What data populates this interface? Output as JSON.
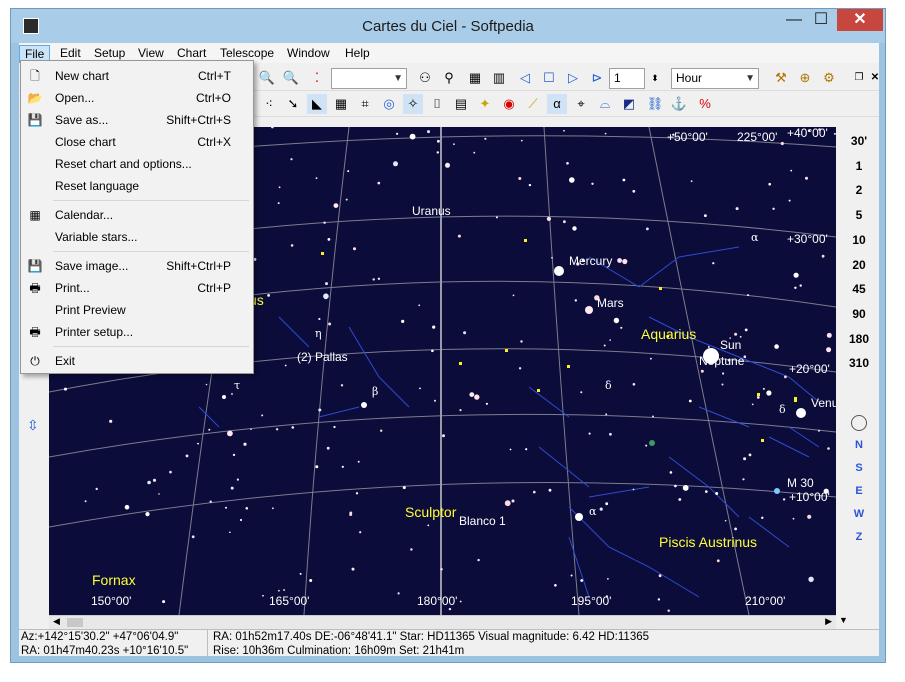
{
  "window": {
    "title": "Cartes du Ciel - Softpedia",
    "min": "—",
    "max": "☐",
    "close": "✕"
  },
  "menu": [
    {
      "label": "File"
    },
    {
      "label": "Edit"
    },
    {
      "label": "Setup"
    },
    {
      "label": "View"
    },
    {
      "label": "Chart"
    },
    {
      "label": "Telescope"
    },
    {
      "label": "Window"
    },
    {
      "label": "Help"
    }
  ],
  "file_menu": [
    {
      "icon": "🗋",
      "icon_name": "new-chart-icon",
      "label": "New chart",
      "shortcut": "Ctrl+T"
    },
    {
      "icon": "📂",
      "icon_name": "open-folder-icon",
      "label": "Open...",
      "shortcut": "Ctrl+O"
    },
    {
      "icon": "💾",
      "icon_name": "save-disk-icon",
      "label": "Save as...",
      "shortcut": "Shift+Ctrl+S"
    },
    {
      "icon": "",
      "icon_name": "",
      "label": "Close chart",
      "shortcut": "Ctrl+X"
    },
    {
      "icon": "",
      "icon_name": "",
      "label": "Reset chart and options...",
      "shortcut": ""
    },
    {
      "icon": "",
      "icon_name": "",
      "label": "Reset language",
      "shortcut": ""
    },
    {
      "sep": true
    },
    {
      "icon": "▦",
      "icon_name": "calendar-icon",
      "label": "Calendar...",
      "shortcut": ""
    },
    {
      "icon": "",
      "icon_name": "",
      "label": "Variable stars...",
      "shortcut": ""
    },
    {
      "sep": true
    },
    {
      "icon": "💾",
      "icon_name": "save-image-icon",
      "label": "Save image...",
      "shortcut": "Shift+Ctrl+P"
    },
    {
      "icon": "🖶",
      "icon_name": "print-icon",
      "label": "Print...",
      "shortcut": "Ctrl+P"
    },
    {
      "icon": "",
      "icon_name": "",
      "label": "Print Preview",
      "shortcut": ""
    },
    {
      "icon": "🖶",
      "icon_name": "printer-setup-icon",
      "label": "Printer setup...",
      "shortcut": ""
    },
    {
      "sep": true
    },
    {
      "icon": "⏻",
      "icon_name": "exit-icon",
      "label": "Exit",
      "shortcut": ""
    }
  ],
  "toolbar": {
    "object_combo": "",
    "step_value": "1",
    "time_unit": "Hour"
  },
  "fov_scale": [
    "30'",
    "1",
    "2",
    "5",
    "10",
    "20",
    "45",
    "90",
    "180",
    "310"
  ],
  "directions": [
    "N",
    "S",
    "E",
    "W",
    "Z"
  ],
  "sky": {
    "labels": [
      {
        "text": "Uranus",
        "color": "#ffffff"
      },
      {
        "text": "Mercury",
        "color": "#ffffff"
      },
      {
        "text": "Mars",
        "color": "#ffffff"
      },
      {
        "text": "Aquarius",
        "color": "#ffff33"
      },
      {
        "text": "Sun",
        "color": "#ffffff"
      },
      {
        "text": "Neptune",
        "color": "#ffffff"
      },
      {
        "text": "(2) Pallas",
        "color": "#ffffff"
      },
      {
        "text": "Sculptor",
        "color": "#ffff33"
      },
      {
        "text": "Blanco 1",
        "color": "#ffffff"
      },
      {
        "text": "Piscis Austrinus",
        "color": "#ffff33"
      },
      {
        "text": "Fornax",
        "color": "#ffff33"
      },
      {
        "text": "M 30",
        "color": "#ffffff"
      },
      {
        "text": "Venu",
        "color": "#ffffff"
      },
      {
        "text": "us",
        "color": "#ffff33"
      }
    ],
    "grid_labels": [
      "+50°00'",
      "225°00'",
      "+40°00'",
      "+30°00'",
      "+20°00'",
      "+10°00'",
      "150°00'",
      "165°00'",
      "180°00'",
      "195°00'",
      "210°00'"
    ],
    "greek": [
      "η",
      "β",
      "τ",
      "α",
      "δ",
      "α",
      "δ"
    ]
  },
  "status": {
    "azalt": "Az:+142°15'30.2\" +47°06'04.9\"",
    "radec": "RA: 01h47m40.23s +10°16'10.5\"",
    "object_line1": "RA: 01h52m17.40s DE:-06°48'41.1\"  Star: HD11365  Visual magnitude:  6.42  HD:11365",
    "object_line2": "Rise: 10h36m   Culmination: 16h09m   Set: 21h41m"
  }
}
